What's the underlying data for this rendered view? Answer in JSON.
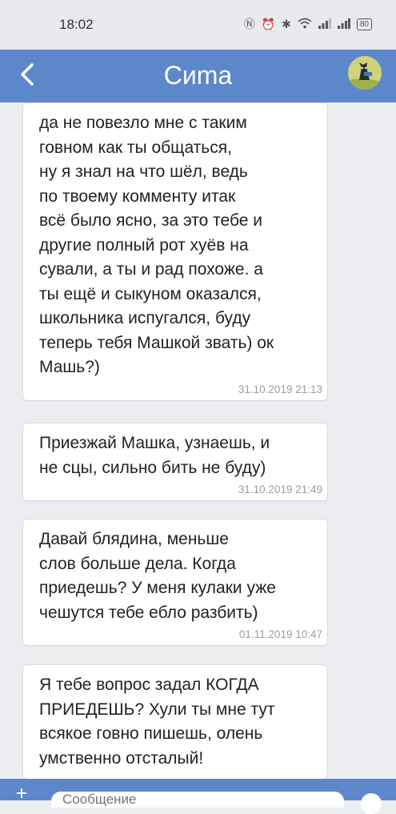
{
  "status_bar": {
    "time": "18:02",
    "battery": "80"
  },
  "header": {
    "title": "Сиmа"
  },
  "messages": [
    {
      "text": "да не повезло мне с таким\nговном как ты общаться,\nну я знал на что шёл, ведь\nпо твоему комменту итак\nвсё было ясно, за это тебе и\nдругие полный рот хуёв на\nсували, а ты и рад похоже. а\nты ещё и сыкуном оказался,\nшкольника испугался, буду\nтеперь тебя Машкой звать) ок\nМашь?)",
      "time": "31.10.2019 21:13"
    },
    {
      "text": "Приезжай Машка, узнаешь, и\nне сцы, сильно бить не буду)",
      "time": "31.10.2019 21:49"
    },
    {
      "text": "Давай блядина, меньше\nслов больше дела. Когда\nприедешь? У меня кулаки уже\nчешутся тебе ебло разбить)",
      "time": "01.11.2019 10:47"
    },
    {
      "text": "Я тебе вопрос задал КОГДА\nПРИЕДЕШЬ? Хули ты мне тут\nвсякое говно пишешь, олень\nумственно отсталый!",
      "time": ""
    }
  ],
  "composer": {
    "placeholder": "Сообщение"
  },
  "colors": {
    "header": "#5c88cb",
    "background": "#ebedf0",
    "bubble": "#ffffff"
  }
}
